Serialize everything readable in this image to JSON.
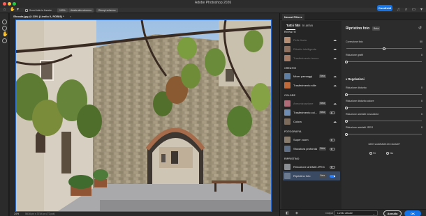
{
  "app": {
    "title": "Adobe Photoshop 2026",
    "share_label": "Condividi"
  },
  "options_bar": {
    "scroll_all_label": "Scorri tutte le finestre",
    "buttons": [
      "100%",
      "Adatta allo schermo",
      "Riempi schermo"
    ]
  },
  "document": {
    "tab_label": "Sfocata.jpg @ 23% (Livello 0, RGB/8) *",
    "zoom": "24%",
    "status_info": "5616 px x 3744 px (72 ppi)"
  },
  "neural_filters": {
    "panel_title": "Neural Filters",
    "tabs": [
      "Tutti i filtri",
      "In arrivo"
    ],
    "categories": {
      "portraits": "RITRATTI",
      "creative": "CREATIVI",
      "color": "COLORE",
      "photography": "FOTOGRAFIA",
      "restoration": "RIPRISTINO"
    },
    "filters": [
      {
        "name": "Pelle liscia",
        "enabled": false,
        "beta": false,
        "cloud": true
      },
      {
        "name": "Ritratto intelligente",
        "enabled": false,
        "beta": false,
        "cloud": true
      },
      {
        "name": "Trasferimento trucco",
        "enabled": false,
        "beta": false,
        "cloud": true
      },
      {
        "name": "Mixer paesaggi",
        "enabled": true,
        "beta": true,
        "cloud": true
      },
      {
        "name": "Trasferimento stile",
        "enabled": true,
        "beta": false,
        "cloud": true
      },
      {
        "name": "Armonizzazione",
        "enabled": false,
        "beta": true,
        "cloud": true
      },
      {
        "name": "Trasferimento col...",
        "enabled": true,
        "beta": true,
        "toggle": "off"
      },
      {
        "name": "Colora",
        "enabled": true,
        "beta": false,
        "cloud": true
      },
      {
        "name": "Super zoom",
        "enabled": true,
        "beta": false,
        "toggle": "off"
      },
      {
        "name": "Sfocatura profonda",
        "enabled": true,
        "beta": true,
        "toggle": "off"
      },
      {
        "name": "Rimozione artefatti JPEG",
        "enabled": true,
        "beta": false,
        "toggle": "off"
      },
      {
        "name": "Ripristino foto",
        "enabled": true,
        "beta": true,
        "toggle": "on",
        "selected": true
      }
    ]
  },
  "settings": {
    "title": "Ripristino foto",
    "beta": "Beta",
    "sliders": [
      {
        "label": "Correzione foto",
        "value": "50",
        "fraction": 0.5
      },
      {
        "label": "Riduzione graffi",
        "value": "0",
        "fraction": 0.0
      }
    ],
    "section": "Regolazioni",
    "adjustments": [
      {
        "label": "Riduzione disturbo",
        "value": "0",
        "fraction": 0.0
      },
      {
        "label": "Riduzione disturbo colore",
        "value": "0",
        "fraction": 0.0
      },
      {
        "label": "Riduzione artefatti mezzatinte",
        "value": "0",
        "fraction": 0.0
      },
      {
        "label": "Riduzione artefatti JPEG",
        "value": "0",
        "fraction": 0.0
      }
    ],
    "feedback_question": "Siete soddisfatti dei risultati?",
    "feedback_yes": "Sì",
    "feedback_no": "No"
  },
  "footer": {
    "output_label": "Output",
    "output_value": "Livello attuale",
    "cancel_label": "Annulla",
    "ok_label": "OK"
  },
  "colors": {
    "accent": "#1473e6",
    "selection": "#3b4a63",
    "toggle_on": "#2d7ff9"
  }
}
